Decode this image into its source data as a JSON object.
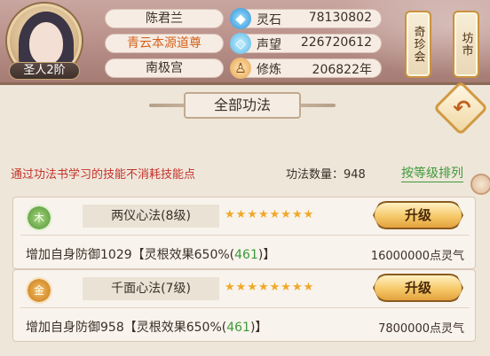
{
  "player": {
    "name": "陈君兰",
    "title": "青云本源道尊",
    "location": "南极宫",
    "rank": "圣人2阶"
  },
  "stats": [
    {
      "icon": "spirit-stone-icon",
      "label": "灵石",
      "value": "78130802"
    },
    {
      "icon": "prestige-icon",
      "label": "声望",
      "value": "226720612"
    },
    {
      "icon": "cultivation-icon",
      "label": "修炼",
      "value": "206822年"
    }
  ],
  "side_buttons": {
    "treasure": "奇珍会",
    "market": "坊市"
  },
  "page": {
    "title": "全部功法",
    "note": "通过功法书学习的技能不消耗技能点",
    "count_label": "功法数量：948",
    "sort_label": "按等级排列"
  },
  "skills": [
    {
      "element": "木",
      "element_icon": "wood-element-icon",
      "name": "两仪心法(8级)",
      "stars": 8,
      "upgrade_label": "升级",
      "effect_prefix": "增加自身防御1029【灵根效果650%(",
      "effect_bonus": "461",
      "effect_suffix": ")】",
      "cost": "16000000点灵气"
    },
    {
      "element": "金",
      "element_icon": "metal-element-icon",
      "name": "千面心法(7级)",
      "stars": 8,
      "upgrade_label": "升级",
      "effect_prefix": "增加自身防御958【灵根效果650%(",
      "effect_bonus": "461",
      "effect_suffix": ")】",
      "cost": "7800000点灵气"
    }
  ],
  "colors": {
    "accent_orange": "#d4641e",
    "note_red": "#c3322a",
    "sort_green": "#3d9a3a",
    "star_gold": "#f0a828"
  }
}
